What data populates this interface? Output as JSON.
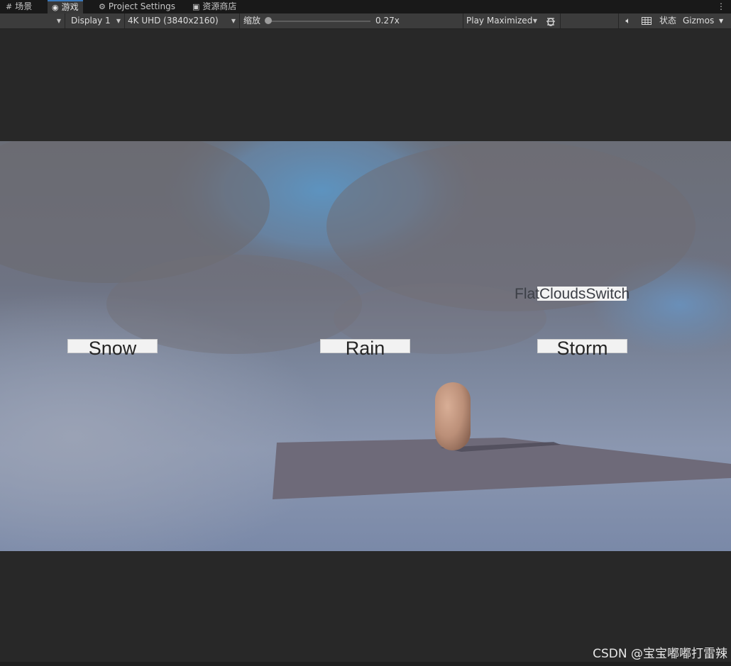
{
  "tabs": [
    {
      "icon": "grid-icon",
      "glyph": "#",
      "label": "场景"
    },
    {
      "icon": "gamepad-icon",
      "glyph": "⊙",
      "label": "游戏"
    },
    {
      "icon": "gear-icon",
      "glyph": "⚙",
      "label": "Project Settings"
    },
    {
      "icon": "bag-icon",
      "glyph": "▣",
      "label": "资源商店"
    }
  ],
  "toolbar": {
    "display": "Display 1",
    "resolution": "4K UHD (3840x2160)",
    "scale_label": "缩放",
    "scale_value": "0.27x",
    "play_mode": "Play Maximized",
    "stats": "状态",
    "gizmos": "Gizmos"
  },
  "game_ui": {
    "snow": "Snow",
    "rain": "Rain",
    "storm": "Storm",
    "toggle": "FlatCloudsSwitch"
  },
  "watermark": "CSDN @宝宝嘟嘟打雷辣"
}
